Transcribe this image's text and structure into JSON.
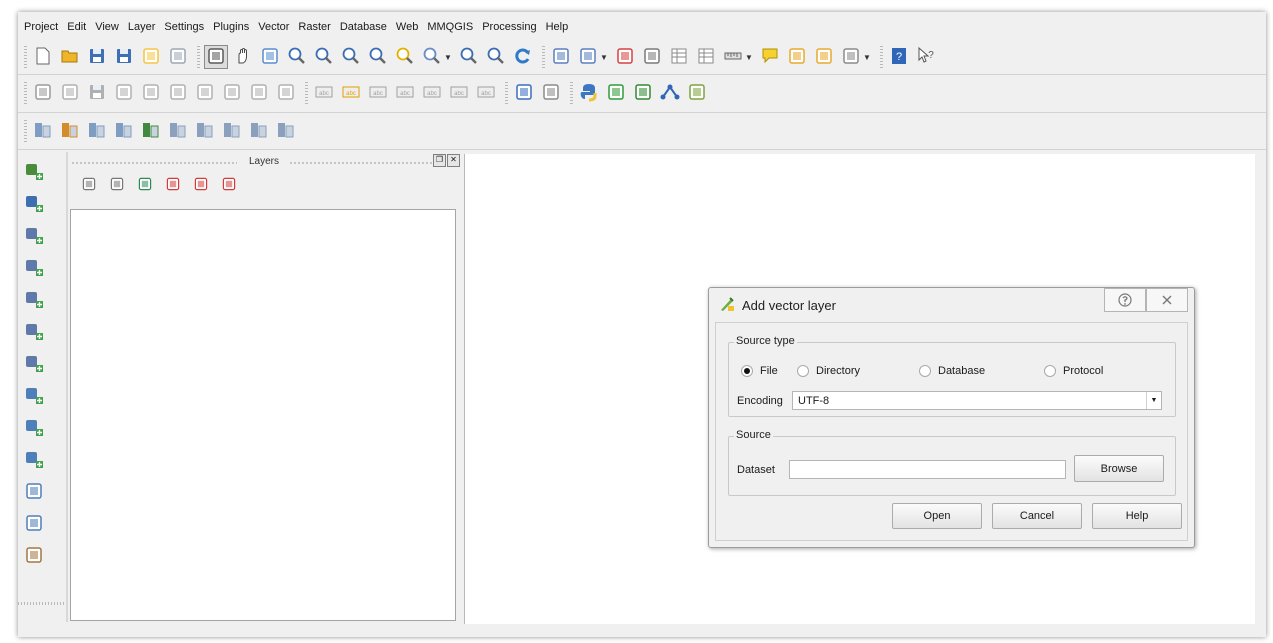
{
  "menu": [
    "Project",
    "Edit",
    "View",
    "Layer",
    "Settings",
    "Plugins",
    "Vector",
    "Raster",
    "Database",
    "Web",
    "MMQGIS",
    "Processing",
    "Help"
  ],
  "toolbar": {
    "row1": [
      {
        "icon": "new-project-icon",
        "color": "#ffffff"
      },
      {
        "icon": "open-project-icon",
        "color": "#f0b429"
      },
      {
        "icon": "save-project-icon",
        "color": "#3f6fb5"
      },
      {
        "icon": "save-as-icon",
        "color": "#3f6fb5"
      },
      {
        "icon": "new-print-composer-icon",
        "color": "#f5c542"
      },
      {
        "icon": "composer-manager-icon",
        "color": "#9aa7b5"
      },
      {
        "icon": "pan-to-selection-icon",
        "color": "#5a5a5a"
      },
      {
        "icon": "pan-hand-icon",
        "color": "#4a4a4a"
      },
      {
        "icon": "pan-map-icon",
        "color": "#5a8ccf"
      },
      {
        "icon": "zoom-in-icon",
        "color": "#3b6db3"
      },
      {
        "icon": "zoom-out-icon",
        "color": "#3b6db3"
      },
      {
        "icon": "zoom-actual-icon",
        "color": "#3b6db3"
      },
      {
        "icon": "zoom-full-icon",
        "color": "#3b6db3"
      },
      {
        "icon": "zoom-layer-icon",
        "color": "#e3b200"
      },
      {
        "icon": "zoom-selection-icon",
        "color": "#6b8cc7"
      },
      {
        "icon": "zoom-last-icon",
        "color": "#3b6db3"
      },
      {
        "icon": "zoom-next-icon",
        "color": "#3b6db3"
      },
      {
        "icon": "refresh-icon",
        "color": "#2f7bc9"
      },
      {
        "icon": "identify-icon",
        "color": "#5a7fbf"
      },
      {
        "icon": "select-icon",
        "color": "#5a7fbf"
      },
      {
        "icon": "deselect-icon",
        "color": "#d94141"
      },
      {
        "icon": "expression-icon",
        "color": "#7a7a7a"
      },
      {
        "icon": "attribute-table-icon",
        "color": "#8a8a8a"
      },
      {
        "icon": "field-calculator-icon",
        "color": "#8a8a8a"
      },
      {
        "icon": "measure-icon",
        "color": "#666666"
      },
      {
        "icon": "map-tips-icon",
        "color": "#f5d131"
      },
      {
        "icon": "new-bookmark-icon",
        "color": "#e8a92c"
      },
      {
        "icon": "show-bookmarks-icon",
        "color": "#e8a92c"
      },
      {
        "icon": "text-annotation-icon",
        "color": "#8a8a8a"
      },
      {
        "icon": "help-book-icon",
        "color": "#2f66b8"
      },
      {
        "icon": "whats-this-icon",
        "color": "#555555"
      }
    ],
    "row2": [
      {
        "icon": "current-edits-icon",
        "color": "#9a9a9a"
      },
      {
        "icon": "toggle-editing-icon",
        "color": "#b0b0b0"
      },
      {
        "icon": "save-edits-icon",
        "color": "#b0b0b0"
      },
      {
        "icon": "add-feature-icon",
        "color": "#b0b0b0"
      },
      {
        "icon": "move-feature-icon",
        "color": "#b0b0b0"
      },
      {
        "icon": "node-tool-icon",
        "color": "#b0b0b0"
      },
      {
        "icon": "delete-selected-icon",
        "color": "#b0b0b0"
      },
      {
        "icon": "cut-features-icon",
        "color": "#b0b0b0"
      },
      {
        "icon": "copy-features-icon",
        "color": "#b0b0b0"
      },
      {
        "icon": "paste-features-icon",
        "color": "#b0b0b0"
      },
      {
        "icon": "label-tool-icon",
        "color": "#a0a0a0"
      },
      {
        "icon": "label-highlight-icon",
        "color": "#e0a100"
      },
      {
        "icon": "pin-labels-icon",
        "color": "#a0a0a0"
      },
      {
        "icon": "show-hide-labels-icon",
        "color": "#a0a0a0"
      },
      {
        "icon": "move-label-icon",
        "color": "#a0a0a0"
      },
      {
        "icon": "rotate-label-icon",
        "color": "#a0a0a0"
      },
      {
        "icon": "change-label-icon",
        "color": "#a0a0a0"
      },
      {
        "icon": "metasearch-icon",
        "color": "#3a6fbf"
      },
      {
        "icon": "csw-icon",
        "color": "#8a8a8a"
      },
      {
        "icon": "python-console-icon",
        "color": "#3c78c2"
      },
      {
        "icon": "grass-tools-icon",
        "color": "#2f9b3a"
      },
      {
        "icon": "plugin-green-icon",
        "color": "#2e8b2e"
      },
      {
        "icon": "plugin-network-icon",
        "color": "#2f66b8"
      },
      {
        "icon": "geocoder-icon",
        "color": "#7fa33d"
      }
    ],
    "row3": [
      {
        "icon": "raster-calc-icon",
        "color": "#7f9cc2"
      },
      {
        "icon": "raster-calc2-icon",
        "color": "#d48b2c"
      },
      {
        "icon": "raster-calc3-icon",
        "color": "#7f9cc2"
      },
      {
        "icon": "raster-histogram-icon",
        "color": "#7f9cc2"
      },
      {
        "icon": "raster-stretch-icon",
        "color": "#3f8a3f"
      },
      {
        "icon": "raster-stretch2-icon",
        "color": "#8aa0bd"
      },
      {
        "icon": "raster-stretch3-icon",
        "color": "#8aa0bd"
      },
      {
        "icon": "raster-stretch4-icon",
        "color": "#8aa0bd"
      },
      {
        "icon": "raster-georef-icon",
        "color": "#8aa0bd"
      },
      {
        "icon": "raster-georef2-icon",
        "color": "#8aa0bd"
      }
    ]
  },
  "left_tools": [
    {
      "icon": "add-vector-layer-icon",
      "color": "#4a8c3c"
    },
    {
      "icon": "add-raster-layer-icon",
      "color": "#3d6fb0"
    },
    {
      "icon": "add-postgis-layer-icon",
      "color": "#5e7aa8"
    },
    {
      "icon": "add-spatialite-layer-icon",
      "color": "#5e7aa8"
    },
    {
      "icon": "add-mssql-layer-icon",
      "color": "#5e7aa8"
    },
    {
      "icon": "add-oracle-layer-icon",
      "color": "#5e7aa8"
    },
    {
      "icon": "add-db2-layer-icon",
      "color": "#5e7aa8"
    },
    {
      "icon": "add-wms-layer-icon",
      "color": "#4f7fb8"
    },
    {
      "icon": "add-wcs-layer-icon",
      "color": "#4f7fb8"
    },
    {
      "icon": "add-wfs-layer-icon",
      "color": "#4f7fb8"
    },
    {
      "icon": "add-delimited-text-icon",
      "color": "#4f7fb8"
    },
    {
      "icon": "new-shapefile-icon",
      "color": "#4f7fb8"
    },
    {
      "icon": "virtual-layer-icon",
      "color": "#a07840"
    }
  ],
  "layers_panel": {
    "title": "Layers",
    "tools": [
      {
        "icon": "layer-style-icon",
        "color": "#777777"
      },
      {
        "icon": "layer-visibility-icon",
        "color": "#777777"
      },
      {
        "icon": "filter-legend-icon",
        "color": "#2e8b57"
      },
      {
        "icon": "expand-all-icon",
        "color": "#d23c3c"
      },
      {
        "icon": "collapse-all-icon",
        "color": "#d23c3c"
      },
      {
        "icon": "remove-layer-icon",
        "color": "#d23c3c"
      }
    ]
  },
  "dialog": {
    "title": "Add vector layer",
    "source_type_label": "Source type",
    "options": [
      {
        "label": "File",
        "selected": true
      },
      {
        "label": "Directory",
        "selected": false
      },
      {
        "label": "Database",
        "selected": false
      },
      {
        "label": "Protocol",
        "selected": false
      }
    ],
    "encoding_label": "Encoding",
    "encoding_value": "UTF-8",
    "source_label": "Source",
    "dataset_label": "Dataset",
    "dataset_value": "",
    "browse_label": "Browse",
    "open_label": "Open",
    "cancel_label": "Cancel",
    "help_label": "Help"
  }
}
